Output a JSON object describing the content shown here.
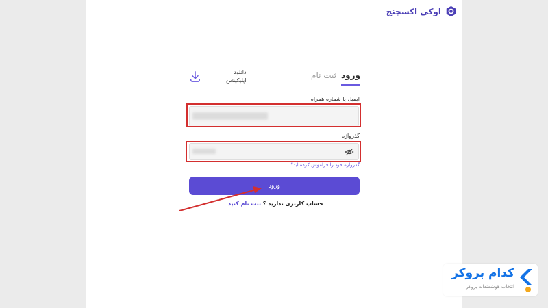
{
  "logo": {
    "text": "اوکی اکسچنج",
    "icon": "hexagon-logo-icon"
  },
  "tabs": {
    "login": "ورود",
    "register": "ثبت نام"
  },
  "download": {
    "line1": "دانلود",
    "line2": "اپلیکیشن",
    "icon": "download-icon"
  },
  "form": {
    "email_label": "ایمیل یا شماره همراه",
    "password_label": "گذرواژه",
    "forgot": "گذرواژه خود را فراموش کرده اید؟",
    "submit": "ورود",
    "no_account": "حساب کاربری ندارید ؟",
    "signup_link": "ثبت نام کنید"
  },
  "watermark": {
    "title": "کدام بروکر",
    "subtitle": "انتخاب هوشمندانه بروکر"
  },
  "colors": {
    "primary": "#5b4bd4",
    "highlight": "#d32f2f",
    "watermark_blue": "#1473e6"
  }
}
